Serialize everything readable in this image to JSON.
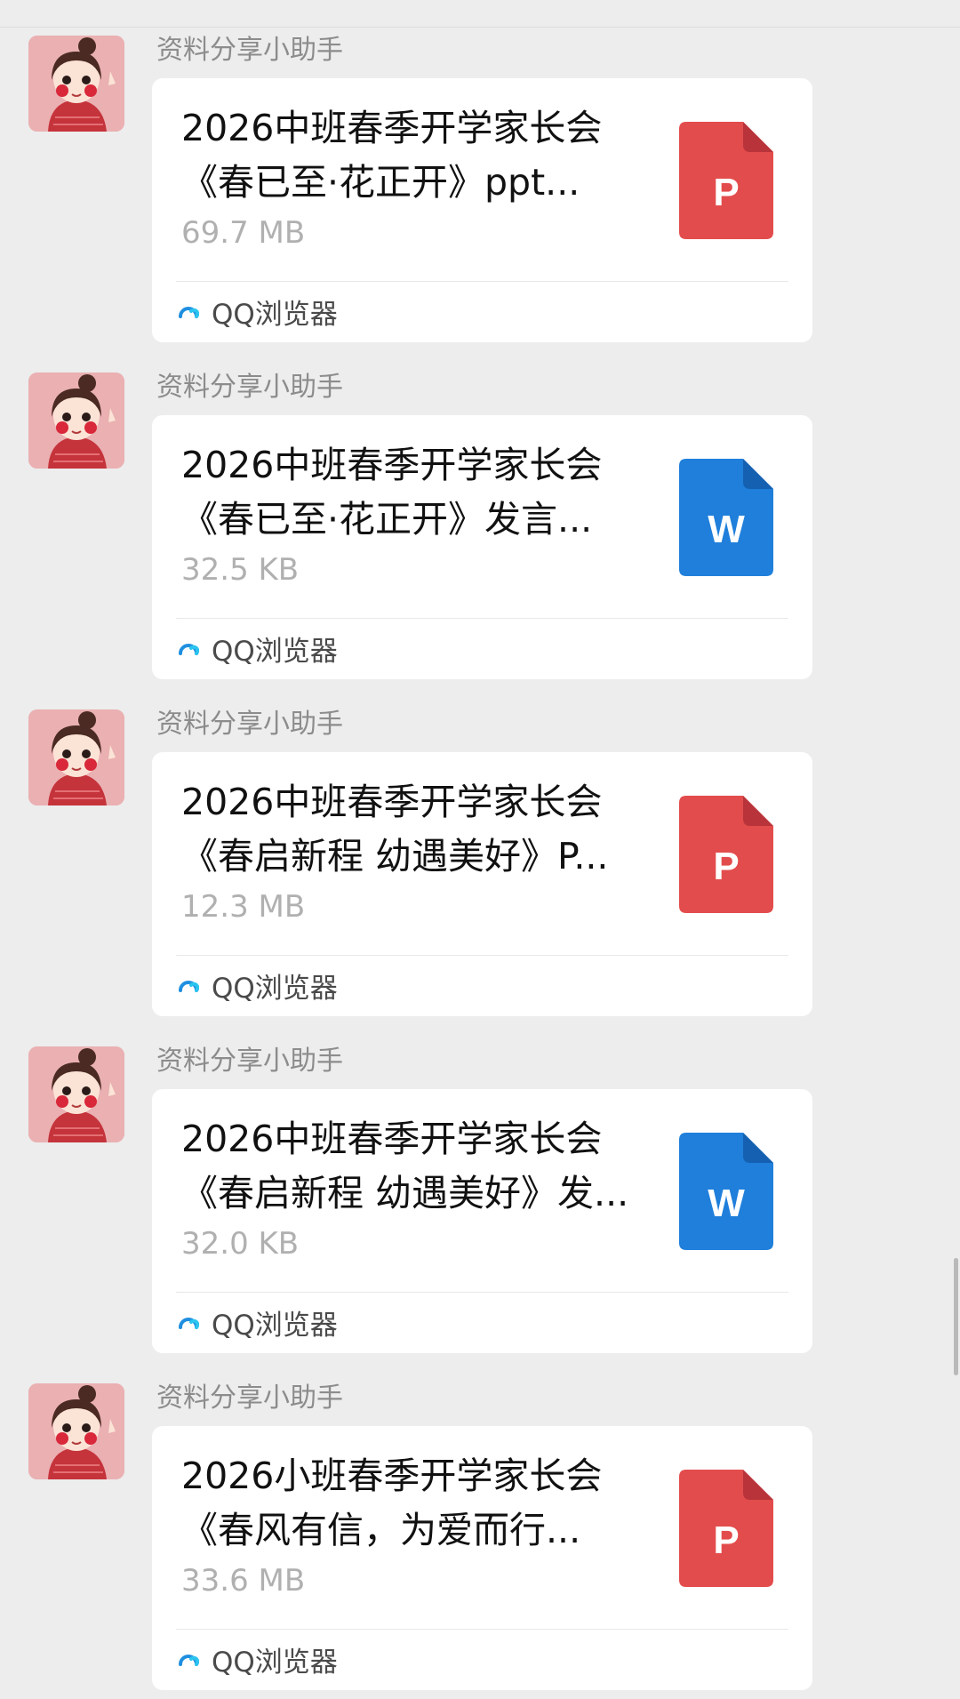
{
  "messages": [
    {
      "sender": "资料分享小助手",
      "title_line1": "2026中班春季开学家长会",
      "title_line2": "《春已至·花正开》ppt...",
      "size": "69.7 MB",
      "file_type": "P",
      "file_color": "#e34c4c",
      "source": "QQ浏览器"
    },
    {
      "sender": "资料分享小助手",
      "title_line1": "2026中班春季开学家长会",
      "title_line2": "《春已至·花正开》发言...",
      "size": "32.5 KB",
      "file_type": "W",
      "file_color": "#1f7fdb",
      "source": "QQ浏览器"
    },
    {
      "sender": "资料分享小助手",
      "title_line1": "2026中班春季开学家长会",
      "title_line2": "《春启新程 幼遇美好》P...",
      "size": "12.3 MB",
      "file_type": "P",
      "file_color": "#e34c4c",
      "source": "QQ浏览器"
    },
    {
      "sender": "资料分享小助手",
      "title_line1": "2026中班春季开学家长会",
      "title_line2": "《春启新程 幼遇美好》发...",
      "size": "32.0 KB",
      "file_type": "W",
      "file_color": "#1f7fdb",
      "source": "QQ浏览器"
    },
    {
      "sender": "资料分享小助手",
      "title_line1": "2026小班春季开学家长会",
      "title_line2": "《春风有信，为爱而行...",
      "size": "33.6 MB",
      "file_type": "P",
      "file_color": "#e34c4c",
      "source": "QQ浏览器"
    }
  ]
}
